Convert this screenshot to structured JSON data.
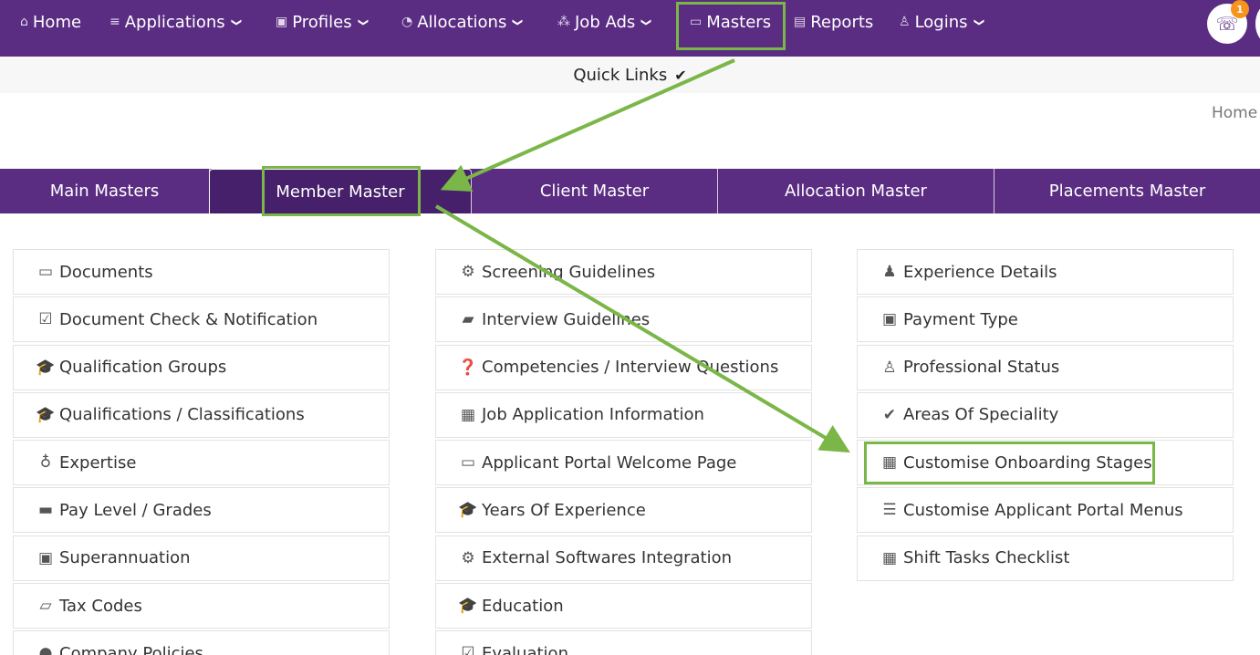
{
  "nav": {
    "items": [
      {
        "label": "Home",
        "icon": "⌂",
        "chevron": ""
      },
      {
        "label": "Applications",
        "icon": "≡",
        "chevron": "❯"
      },
      {
        "label": "Profiles",
        "icon": "▣",
        "chevron": "❯"
      },
      {
        "label": "Allocations",
        "icon": "◔",
        "chevron": "❯"
      },
      {
        "label": "Job Ads",
        "icon": "⁂",
        "chevron": "❯"
      },
      {
        "label": "Masters",
        "icon": "▭",
        "chevron": ""
      },
      {
        "label": "Reports",
        "icon": "▤",
        "chevron": ""
      },
      {
        "label": "Logins",
        "icon": "♙",
        "chevron": "❯"
      }
    ],
    "phone_icon": "☏",
    "notification_count": "1"
  },
  "quick_links": {
    "label": "Quick Links",
    "check": "✔"
  },
  "breadcrumb": {
    "home": "Home"
  },
  "tabs": [
    {
      "label": "Main Masters"
    },
    {
      "label": "Member Master"
    },
    {
      "label": "Client Master"
    },
    {
      "label": "Allocation Master"
    },
    {
      "label": "Placements Master"
    }
  ],
  "columns": [
    [
      {
        "label": "Documents",
        "icon": "▭"
      },
      {
        "label": "Document Check & Notification",
        "icon": "☑"
      },
      {
        "label": "Qualification Groups",
        "icon": "🎓"
      },
      {
        "label": "Qualifications / Classifications",
        "icon": "🎓"
      },
      {
        "label": "Expertise",
        "icon": "♁"
      },
      {
        "label": "Pay Level / Grades",
        "icon": "▬"
      },
      {
        "label": "Superannuation",
        "icon": "▣"
      },
      {
        "label": "Tax Codes",
        "icon": "▱"
      },
      {
        "label": "Company Policies",
        "icon": "●"
      }
    ],
    [
      {
        "label": "Screening Guidelines",
        "icon": "⚙"
      },
      {
        "label": "Interview Guidelines",
        "icon": "▰"
      },
      {
        "label": "Competencies / Interview Questions",
        "icon": "❓"
      },
      {
        "label": "Job Application Information",
        "icon": "▦"
      },
      {
        "label": "Applicant Portal Welcome Page",
        "icon": "▭"
      },
      {
        "label": "Years Of Experience",
        "icon": "🎓"
      },
      {
        "label": "External Softwares Integration",
        "icon": "⚙"
      },
      {
        "label": "Education",
        "icon": "🎓"
      },
      {
        "label": "Evaluation",
        "icon": "☑"
      }
    ],
    [
      {
        "label": "Experience Details",
        "icon": "♟"
      },
      {
        "label": "Payment Type",
        "icon": "▣"
      },
      {
        "label": "Professional Status",
        "icon": "♙"
      },
      {
        "label": "Areas Of Speciality",
        "icon": "✔"
      },
      {
        "label": "Customise Onboarding Stages",
        "icon": "▦"
      },
      {
        "label": "Customise Applicant Portal Menus",
        "icon": "☰"
      },
      {
        "label": "Shift Tasks Checklist",
        "icon": "▦"
      }
    ]
  ],
  "colors": {
    "nav_purple": "#5a2d82",
    "active_tab": "#46206a",
    "annotation_green": "#7ab648",
    "badge_orange": "#f7941d"
  }
}
